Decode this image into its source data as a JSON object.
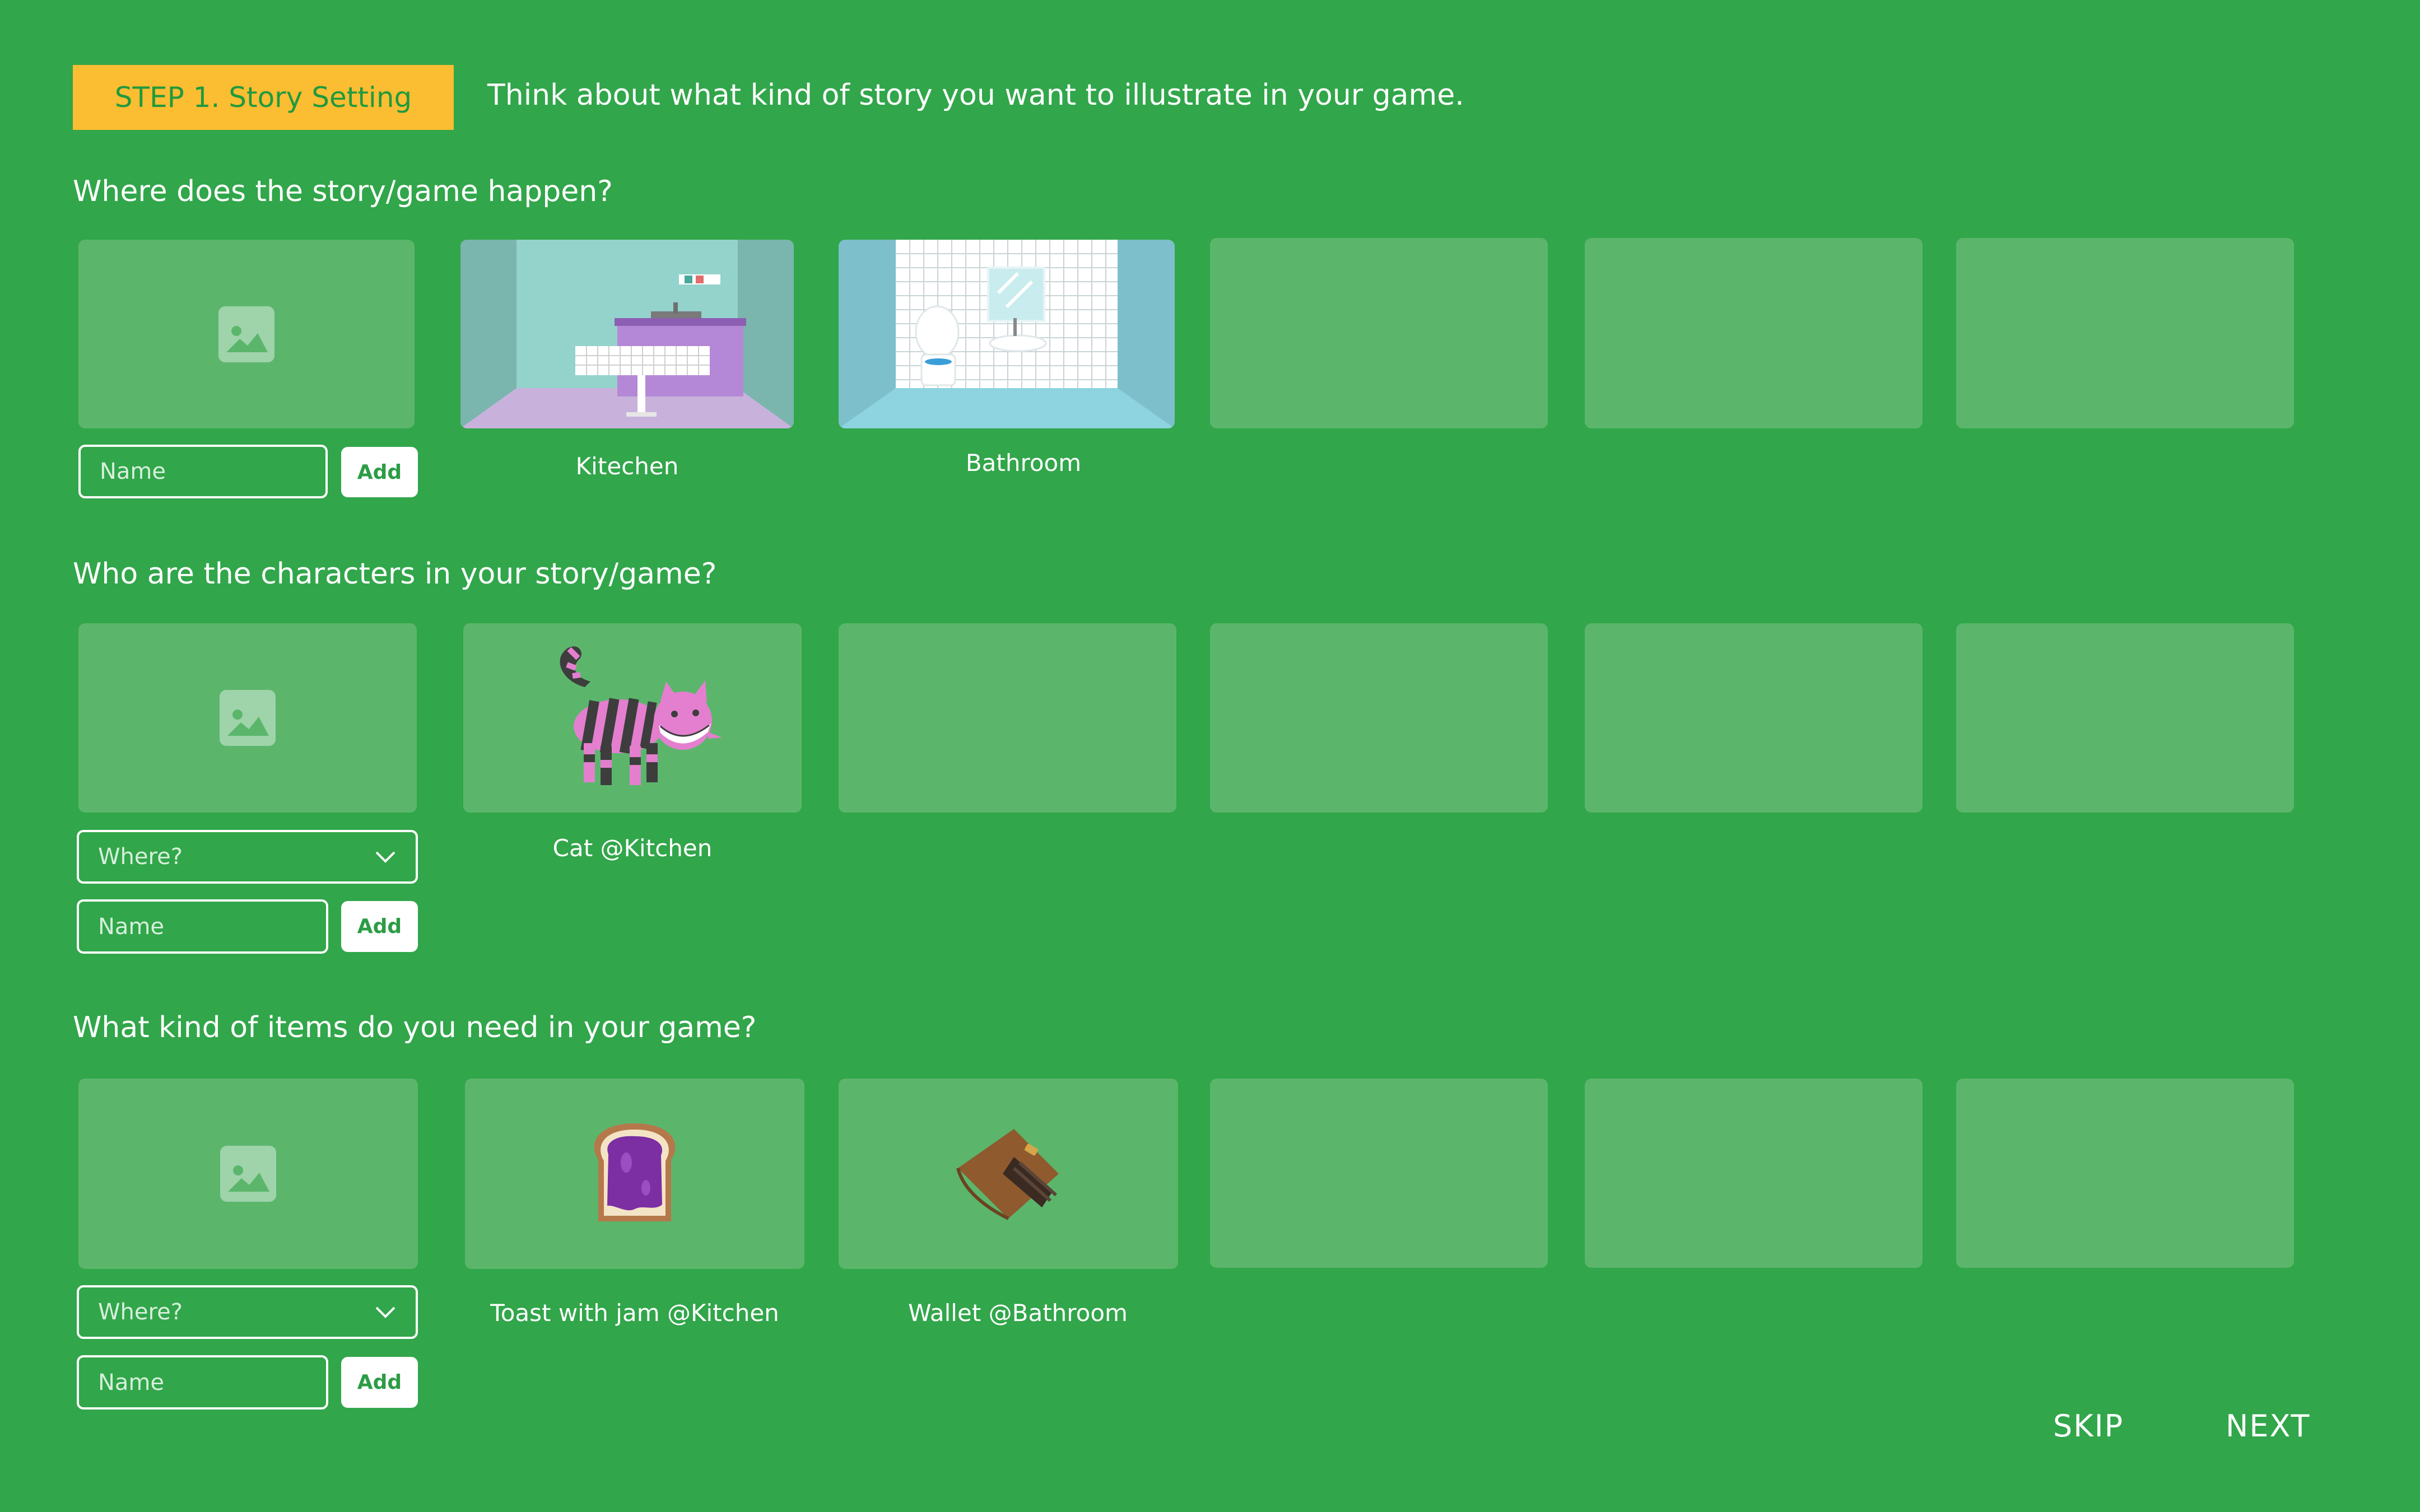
{
  "header": {
    "step_label": "STEP 1. Story Setting",
    "description": "Think about what kind of story you want to illustrate in your game."
  },
  "sections": {
    "settings": {
      "question": "Where does the story/game happen?",
      "name_placeholder": "Name",
      "add_label": "Add",
      "items": [
        {
          "caption": "Kitechen",
          "image": "kitchen-scene"
        },
        {
          "caption": "Bathroom",
          "image": "bathroom-scene"
        }
      ]
    },
    "characters": {
      "question": "Who are the characters in your story/game?",
      "where_placeholder": "Where?",
      "name_placeholder": "Name",
      "add_label": "Add",
      "items": [
        {
          "caption": "Cat @Kitchen",
          "image": "striped-cat"
        }
      ]
    },
    "items": {
      "question": "What kind of items do you need in your game?",
      "where_placeholder": "Where?",
      "name_placeholder": "Name",
      "add_label": "Add",
      "items": [
        {
          "caption": "Toast with jam @Kitchen",
          "image": "toast-with-jam"
        },
        {
          "caption": "Wallet @Bathroom",
          "image": "wallet"
        }
      ]
    }
  },
  "footer": {
    "skip_label": "SKIP",
    "next_label": "NEXT"
  },
  "colors": {
    "background": "#31a64a",
    "card": "#5bb66c",
    "badge": "#fbbd32",
    "button_text": "#2c9c45"
  }
}
